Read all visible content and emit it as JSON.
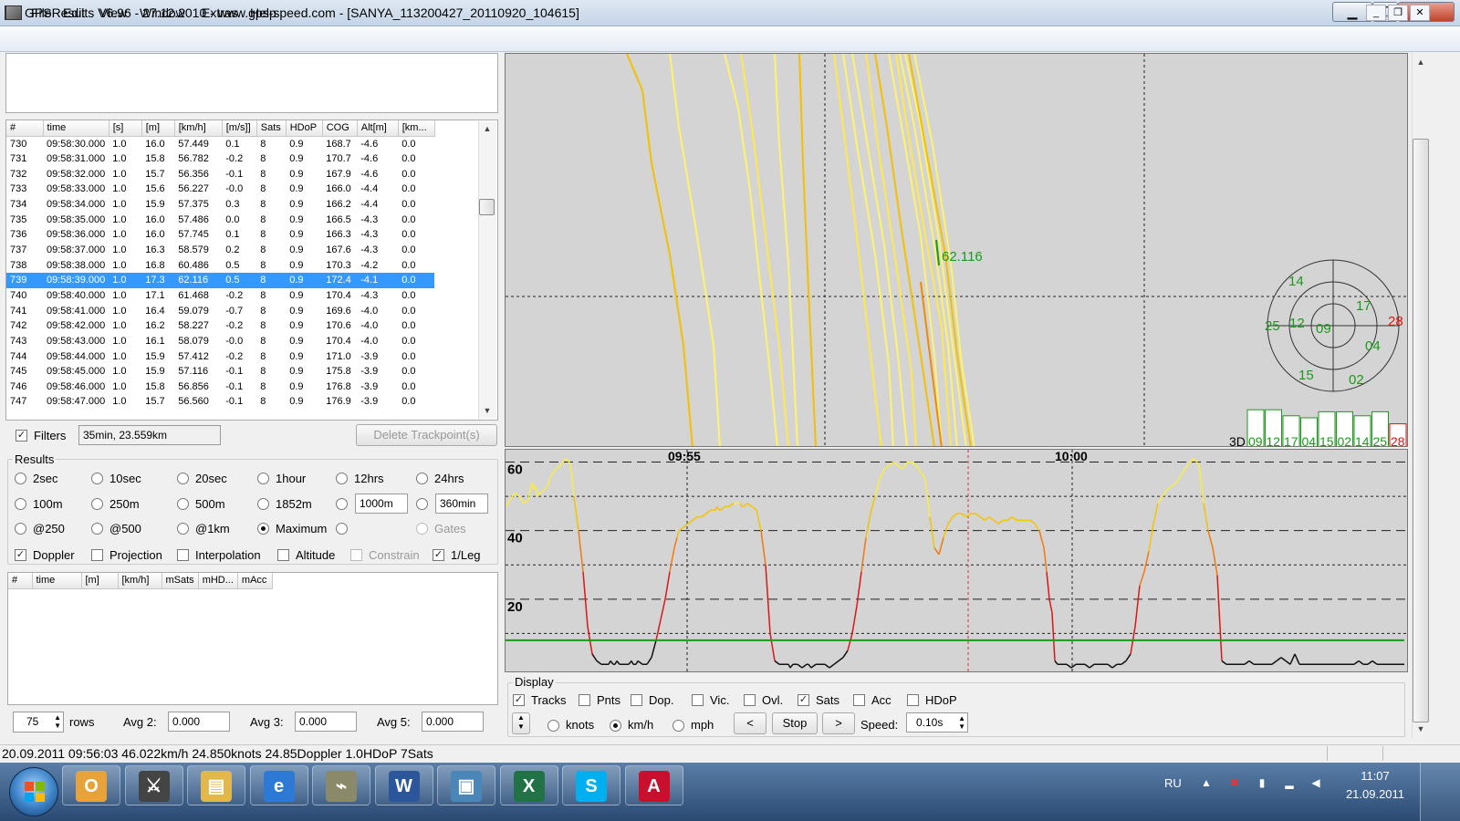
{
  "window": {
    "title": "GPSResults V6.96 - 27.12.2010 - www.gps-speed.com - [SANYA_113200427_20110920_104615]"
  },
  "menu": [
    "File",
    "Edit",
    "View",
    "Window",
    "Extras",
    "Help"
  ],
  "trackpoints": {
    "columns": [
      "#",
      "time",
      "[s]",
      "[m]",
      "[km/h]",
      "[m/s]]",
      "Sats",
      "HDoP",
      "COG",
      "Alt[m]",
      "[km..."
    ],
    "selected_index": 9,
    "rows": [
      [
        "730",
        "09:58:30.000",
        "1.0",
        "16.0",
        "57.449",
        "0.1",
        "8",
        "0.9",
        "168.7",
        "-4.6",
        "0.0"
      ],
      [
        "731",
        "09:58:31.000",
        "1.0",
        "15.8",
        "56.782",
        "-0.2",
        "8",
        "0.9",
        "170.7",
        "-4.6",
        "0.0"
      ],
      [
        "732",
        "09:58:32.000",
        "1.0",
        "15.7",
        "56.356",
        "-0.1",
        "8",
        "0.9",
        "167.9",
        "-4.6",
        "0.0"
      ],
      [
        "733",
        "09:58:33.000",
        "1.0",
        "15.6",
        "56.227",
        "-0.0",
        "8",
        "0.9",
        "166.0",
        "-4.4",
        "0.0"
      ],
      [
        "734",
        "09:58:34.000",
        "1.0",
        "15.9",
        "57.375",
        "0.3",
        "8",
        "0.9",
        "166.2",
        "-4.4",
        "0.0"
      ],
      [
        "735",
        "09:58:35.000",
        "1.0",
        "16.0",
        "57.486",
        "0.0",
        "8",
        "0.9",
        "166.5",
        "-4.3",
        "0.0"
      ],
      [
        "736",
        "09:58:36.000",
        "1.0",
        "16.0",
        "57.745",
        "0.1",
        "8",
        "0.9",
        "166.3",
        "-4.3",
        "0.0"
      ],
      [
        "737",
        "09:58:37.000",
        "1.0",
        "16.3",
        "58.579",
        "0.2",
        "8",
        "0.9",
        "167.6",
        "-4.3",
        "0.0"
      ],
      [
        "738",
        "09:58:38.000",
        "1.0",
        "16.8",
        "60.486",
        "0.5",
        "8",
        "0.9",
        "170.3",
        "-4.2",
        "0.0"
      ],
      [
        "739",
        "09:58:39.000",
        "1.0",
        "17.3",
        "62.116",
        "0.5",
        "8",
        "0.9",
        "172.4",
        "-4.1",
        "0.0"
      ],
      [
        "740",
        "09:58:40.000",
        "1.0",
        "17.1",
        "61.468",
        "-0.2",
        "8",
        "0.9",
        "170.4",
        "-4.3",
        "0.0"
      ],
      [
        "741",
        "09:58:41.000",
        "1.0",
        "16.4",
        "59.079",
        "-0.7",
        "8",
        "0.9",
        "169.6",
        "-4.0",
        "0.0"
      ],
      [
        "742",
        "09:58:42.000",
        "1.0",
        "16.2",
        "58.227",
        "-0.2",
        "8",
        "0.9",
        "170.6",
        "-4.0",
        "0.0"
      ],
      [
        "743",
        "09:58:43.000",
        "1.0",
        "16.1",
        "58.079",
        "-0.0",
        "8",
        "0.9",
        "170.4",
        "-4.0",
        "0.0"
      ],
      [
        "744",
        "09:58:44.000",
        "1.0",
        "15.9",
        "57.412",
        "-0.2",
        "8",
        "0.9",
        "171.0",
        "-3.9",
        "0.0"
      ],
      [
        "745",
        "09:58:45.000",
        "1.0",
        "15.9",
        "57.116",
        "-0.1",
        "8",
        "0.9",
        "175.8",
        "-3.9",
        "0.0"
      ],
      [
        "746",
        "09:58:46.000",
        "1.0",
        "15.8",
        "56.856",
        "-0.1",
        "8",
        "0.9",
        "176.8",
        "-3.9",
        "0.0"
      ],
      [
        "747",
        "09:58:47.000",
        "1.0",
        "15.7",
        "56.560",
        "-0.1",
        "8",
        "0.9",
        "176.9",
        "-3.9",
        "0.0"
      ]
    ]
  },
  "filters": {
    "checked": true,
    "label": "Filters",
    "value": "35min, 23.559km",
    "delete_button": "Delete Trackpoint(s)"
  },
  "results": {
    "label": "Results",
    "radios": [
      {
        "label": "2sec",
        "checked": false
      },
      {
        "label": "10sec",
        "checked": false
      },
      {
        "label": "20sec",
        "checked": false
      },
      {
        "label": "1hour",
        "checked": false
      },
      {
        "label": "12hrs",
        "checked": false
      },
      {
        "label": "24hrs",
        "checked": false
      },
      {
        "label": "100m",
        "checked": false
      },
      {
        "label": "250m",
        "checked": false
      },
      {
        "label": "500m",
        "checked": false
      },
      {
        "label": "1852m",
        "checked": false
      },
      {
        "label": "",
        "checked": false
      },
      {
        "label": "",
        "checked": false
      },
      {
        "label": "@250",
        "checked": false
      },
      {
        "label": "@500",
        "checked": false
      },
      {
        "label": "@1km",
        "checked": false
      },
      {
        "label": "Maximum",
        "checked": true
      },
      {
        "label": "",
        "checked": false
      },
      {
        "label": "Gates",
        "checked": false,
        "disabled": true
      }
    ],
    "custom_distance": "1000m",
    "custom_time": "360min",
    "checkboxes": [
      {
        "label": "Doppler",
        "checked": true
      },
      {
        "label": "Projection",
        "checked": false
      },
      {
        "label": "Interpolation",
        "checked": false
      },
      {
        "label": "Altitude",
        "checked": false
      },
      {
        "label": "Constrain",
        "checked": false,
        "disabled": true
      },
      {
        "label": "1/Leg",
        "checked": true
      }
    ],
    "table_columns": [
      "#",
      "time",
      "[m]",
      "[km/h]",
      "mSats",
      "mHD...",
      "mAcc"
    ]
  },
  "bottom_left": {
    "rows_value": "75",
    "rows_label": "rows",
    "avg2_label": "Avg 2:",
    "avg2_value": "0.000",
    "avg3_label": "Avg 3:",
    "avg3_value": "0.000",
    "avg5_label": "Avg 5:",
    "avg5_value": "0.000"
  },
  "map": {
    "speed_label": "62.116",
    "satellites_radar": [
      {
        "id": "14",
        "color": "#1a9a1a"
      },
      {
        "id": "17",
        "color": "#1a9a1a"
      },
      {
        "id": "25",
        "color": "#1a9a1a"
      },
      {
        "id": "12",
        "color": "#1a9a1a"
      },
      {
        "id": "09",
        "color": "#1a9a1a"
      },
      {
        "id": "28",
        "color": "#e01010"
      },
      {
        "id": "04",
        "color": "#1a9a1a"
      },
      {
        "id": "15",
        "color": "#1a9a1a"
      },
      {
        "id": "02",
        "color": "#1a9a1a"
      }
    ],
    "fix_label": "3D",
    "sat_bars": [
      {
        "id": "09",
        "level": 0.95,
        "color": "#1a9a1a"
      },
      {
        "id": "12",
        "level": 0.95,
        "color": "#1a9a1a"
      },
      {
        "id": "17",
        "level": 0.8,
        "color": "#1a9a1a"
      },
      {
        "id": "04",
        "level": 0.75,
        "color": "#1a9a1a"
      },
      {
        "id": "15",
        "level": 0.9,
        "color": "#1a9a1a"
      },
      {
        "id": "02",
        "level": 0.9,
        "color": "#1a9a1a"
      },
      {
        "id": "14",
        "level": 0.8,
        "color": "#1a9a1a"
      },
      {
        "id": "25",
        "level": 0.9,
        "color": "#1a9a1a"
      },
      {
        "id": "28",
        "level": 0.6,
        "color": "#e01010"
      }
    ]
  },
  "chart_data": {
    "type": "line",
    "title": "",
    "xlabel": "",
    "ylabel": "",
    "x_ticks": [
      "09:55",
      "10:00"
    ],
    "y_ticks": [
      "20",
      "40",
      "60"
    ],
    "ylim": [
      0,
      62
    ],
    "grid": true,
    "series": [
      {
        "color": "speed-gradient",
        "x": [
          0,
          5,
          10,
          15,
          20,
          25,
          27,
          29,
          31,
          33,
          35,
          38,
          43,
          46,
          50,
          55,
          60,
          65,
          70,
          72,
          75,
          80,
          85,
          90,
          95,
          100,
          105,
          110,
          113,
          115,
          118,
          120,
          122,
          125,
          128,
          130,
          132,
          135,
          138,
          140,
          143,
          145,
          150,
          155,
          160,
          165,
          170,
          175,
          180,
          185,
          188,
          190,
          195,
          200,
          205,
          210,
          215,
          220,
          225,
          230,
          232,
          234,
          236,
          240,
          245,
          250,
          255,
          257,
          259,
          261,
          265,
          270,
          275,
          280,
          285,
          290,
          295,
          300,
          305,
          310,
          312,
          315,
          320,
          325,
          330,
          332,
          335,
          340,
          345,
          350,
          355,
          360,
          365,
          370,
          375,
          380,
          385,
          390,
          395,
          400,
          405,
          410,
          415,
          420,
          425,
          430,
          435,
          440,
          445,
          450,
          455,
          460,
          465,
          470,
          475,
          480,
          485,
          490,
          495,
          500,
          505,
          510,
          515,
          520,
          525,
          530,
          535,
          540,
          545,
          550,
          555,
          560,
          565,
          570,
          575,
          580,
          585,
          590,
          593,
          596,
          599,
          602,
          605,
          610,
          615,
          620,
          625,
          630,
          635,
          640,
          645,
          650,
          655,
          660,
          665,
          670,
          675,
          680,
          685,
          690,
          695,
          700,
          705,
          710,
          715,
          720,
          725,
          730,
          735,
          740,
          745,
          750,
          755,
          760,
          765,
          770,
          775,
          780,
          785,
          790,
          795,
          800,
          805,
          810,
          815,
          820,
          825,
          830,
          835,
          840,
          845,
          850,
          855,
          860,
          865,
          870,
          875,
          880,
          885,
          890,
          895,
          900,
          905,
          910,
          915,
          920,
          925,
          930,
          935,
          940,
          945,
          950,
          955,
          960,
          965,
          970,
          975,
          980,
          985
        ],
        "y": [
          47,
          49,
          51,
          50,
          48,
          49,
          52,
          54,
          52,
          53,
          50,
          51,
          52,
          53,
          56,
          58,
          59,
          61,
          60,
          57,
          50,
          40,
          28,
          12,
          4,
          2,
          1,
          1,
          1,
          2,
          1,
          1,
          2,
          1,
          1,
          1,
          1,
          1,
          2,
          1,
          1,
          2,
          1,
          1,
          3,
          8,
          14,
          20,
          28,
          35,
          38,
          40,
          41,
          42,
          43,
          44,
          44,
          45,
          46,
          46,
          47,
          46,
          46,
          47,
          47,
          48,
          48,
          48,
          47,
          47,
          48,
          47,
          46,
          40,
          30,
          10,
          2,
          1,
          1,
          1,
          0,
          1,
          1,
          0,
          1,
          1,
          0,
          1,
          1,
          1,
          0,
          1,
          2,
          3,
          5,
          10,
          18,
          28,
          38,
          45,
          50,
          55,
          58,
          59,
          60,
          59,
          58,
          60,
          60,
          59,
          57,
          55,
          44,
          35,
          33,
          38,
          42,
          44,
          45,
          45,
          44,
          45,
          45,
          44,
          43,
          44,
          43,
          42,
          43,
          43,
          44,
          43,
          43,
          43,
          43,
          42,
          40,
          35,
          28,
          20,
          16,
          2,
          1,
          1,
          1,
          0,
          1,
          1,
          1,
          0,
          1,
          1,
          1,
          1,
          0,
          1,
          1,
          2,
          4,
          12,
          24,
          28,
          34,
          42,
          48,
          50,
          52,
          53,
          54,
          56,
          58,
          60,
          61,
          59,
          48,
          40,
          35,
          27,
          2,
          1,
          1,
          1,
          1,
          1,
          2,
          1,
          1,
          1,
          1,
          1,
          2,
          3,
          2,
          1,
          4,
          1,
          1,
          1,
          1,
          1,
          1,
          1,
          1,
          1,
          1,
          1,
          1,
          1,
          2,
          1,
          1,
          2,
          1,
          1,
          1,
          1,
          1,
          1,
          1
        ]
      },
      {
        "color": "#1a9a1a",
        "x": [
          0,
          985
        ],
        "y": [
          8,
          8
        ]
      }
    ]
  },
  "display": {
    "label": "Display",
    "checkboxes": [
      {
        "label": "Tracks",
        "checked": true
      },
      {
        "label": "Pnts",
        "checked": false
      },
      {
        "label": "Dop.",
        "checked": false
      },
      {
        "label": "Vic.",
        "checked": false
      },
      {
        "label": "Ovl.",
        "checked": false
      },
      {
        "label": "Sats",
        "checked": true
      },
      {
        "label": "Acc",
        "checked": false
      },
      {
        "label": "HDoP",
        "checked": false
      }
    ],
    "units": [
      {
        "label": "knots",
        "checked": false
      },
      {
        "label": "km/h",
        "checked": true
      },
      {
        "label": "mph",
        "checked": false
      }
    ],
    "prev_button": "<",
    "stop_button": "Stop",
    "next_button": ">",
    "speed_label": "Speed:",
    "speed_value": "0.10s"
  },
  "status": {
    "text": "20.09.2011 09:56:03 46.022km/h 24.850knots 24.85Doppler  1.0HDoP  7Sats"
  },
  "taskbar": {
    "apps": [
      {
        "name": "outlook",
        "glyph": "O",
        "color": "#e8a23a"
      },
      {
        "name": "counter-strike",
        "glyph": "⚔",
        "color": "#444"
      },
      {
        "name": "explorer",
        "glyph": "▤",
        "color": "#e2b84a"
      },
      {
        "name": "internet-explorer",
        "glyph": "e",
        "color": "#2d7ad6"
      },
      {
        "name": "gpsresults",
        "glyph": "⌁",
        "color": "#8a8a6a"
      },
      {
        "name": "word",
        "glyph": "W",
        "color": "#2b579a"
      },
      {
        "name": "photo-viewer",
        "glyph": "▣",
        "color": "#4a86b8"
      },
      {
        "name": "excel",
        "glyph": "X",
        "color": "#217346"
      },
      {
        "name": "skype",
        "glyph": "S",
        "color": "#00aff0"
      },
      {
        "name": "acrobat",
        "glyph": "A",
        "color": "#c8102e"
      }
    ],
    "language": "RU",
    "time": "11:07",
    "date": "21.09.2011"
  }
}
